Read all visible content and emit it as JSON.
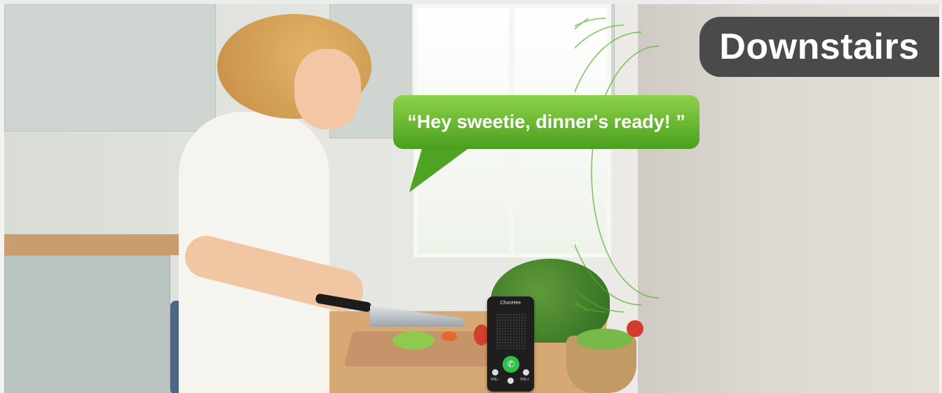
{
  "overlay": {
    "location_badge": "Downstairs",
    "speech_bubble": "“Hey sweetie, dinner's ready! ”"
  },
  "device": {
    "brand": "ChunHee",
    "vol_minus": "VOL-",
    "vol_plus": "VOL+"
  },
  "colors": {
    "badge_bg": "#4a4a4a",
    "bubble_green": "#6cbf34",
    "call_green": "#2fbf4a",
    "wave_green": "#4caf2a"
  },
  "icons": {
    "call": "phone-icon"
  }
}
